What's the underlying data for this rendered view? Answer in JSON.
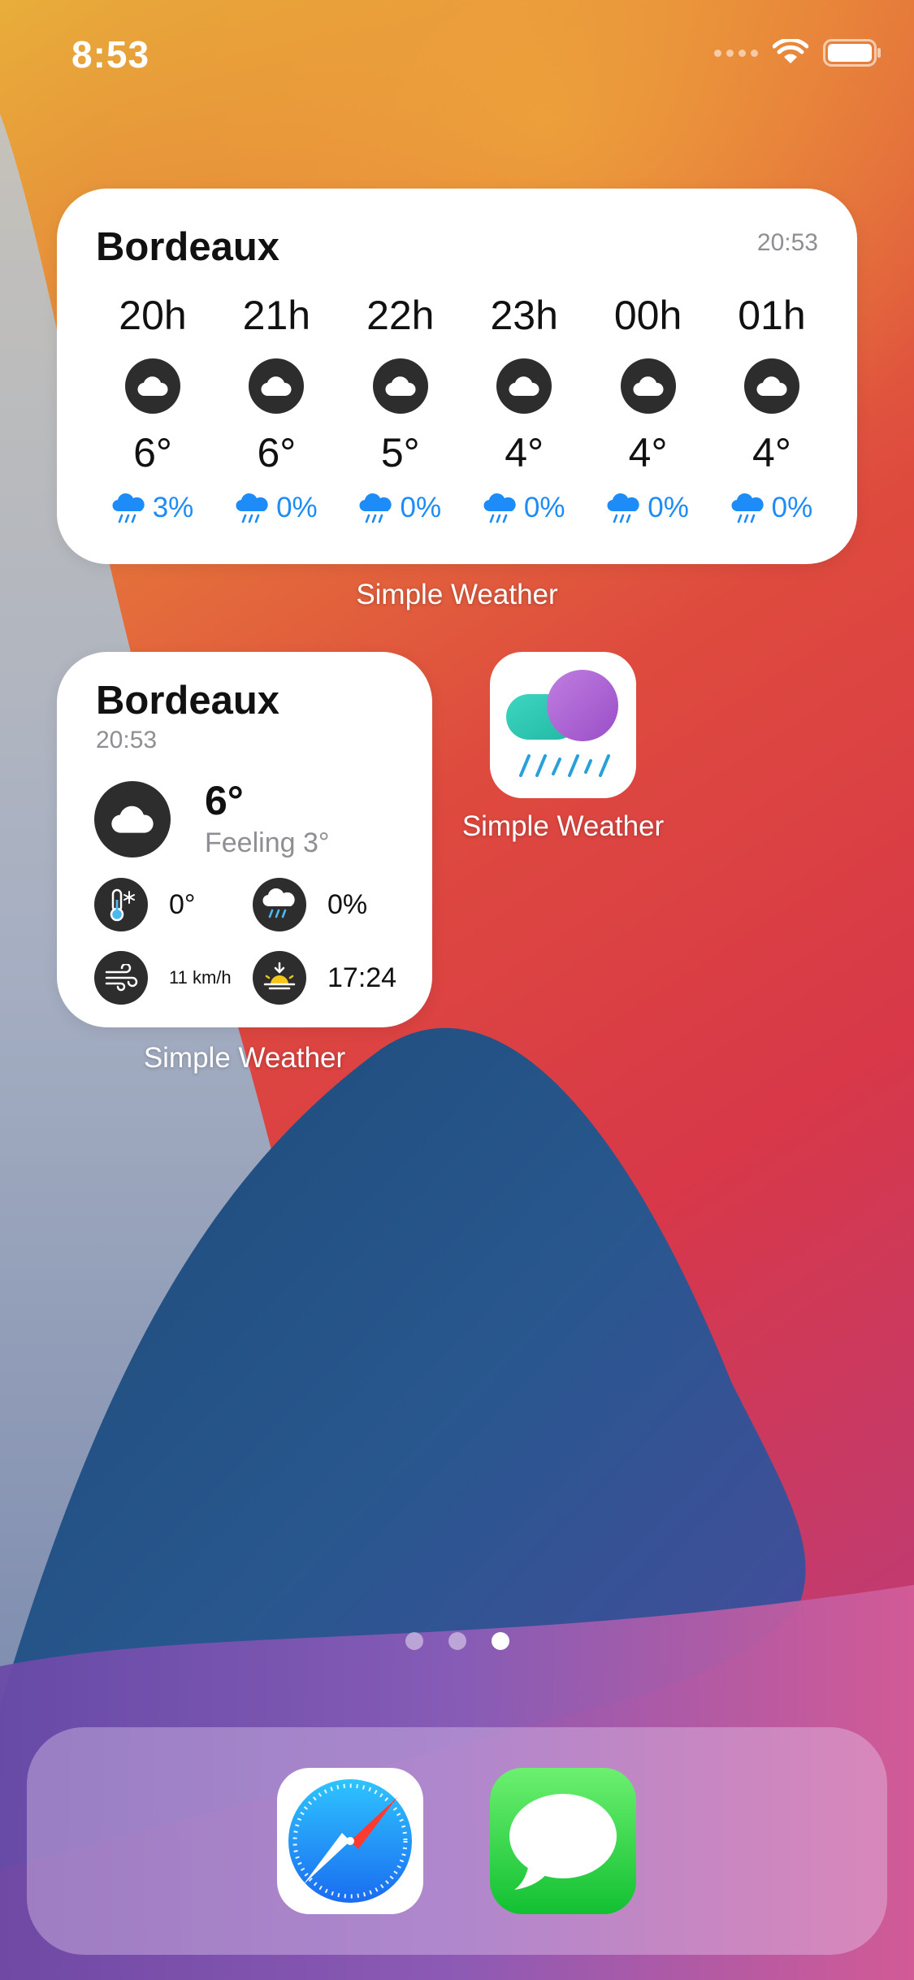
{
  "status_bar": {
    "time": "8:53"
  },
  "large_widget": {
    "city": "Bordeaux",
    "updated": "20:53",
    "hours": [
      {
        "label": "20h",
        "icon": "cloud-icon",
        "temp": "6°",
        "precip": "3%"
      },
      {
        "label": "21h",
        "icon": "cloud-icon",
        "temp": "6°",
        "precip": "0%"
      },
      {
        "label": "22h",
        "icon": "cloud-icon",
        "temp": "5°",
        "precip": "0%"
      },
      {
        "label": "23h",
        "icon": "cloud-icon",
        "temp": "4°",
        "precip": "0%"
      },
      {
        "label": "00h",
        "icon": "cloud-icon",
        "temp": "4°",
        "precip": "0%"
      },
      {
        "label": "01h",
        "icon": "cloud-icon",
        "temp": "4°",
        "precip": "0%"
      }
    ],
    "app_label": "Simple Weather"
  },
  "small_widget": {
    "city": "Bordeaux",
    "updated": "20:53",
    "temp": "6°",
    "feeling": "Feeling 3°",
    "stats": {
      "low_temp": "0°",
      "precip": "0%",
      "wind": "11 km/h",
      "sunset": "17:24"
    },
    "app_label": "Simple Weather"
  },
  "app_icon": {
    "label": "Simple Weather"
  },
  "page_indicator": {
    "pages": 3,
    "current": 3
  },
  "colors": {
    "precip_blue": "#1d8cf8",
    "icon_dark": "#2d2d2d",
    "secondary_text": "#8e8e93"
  }
}
